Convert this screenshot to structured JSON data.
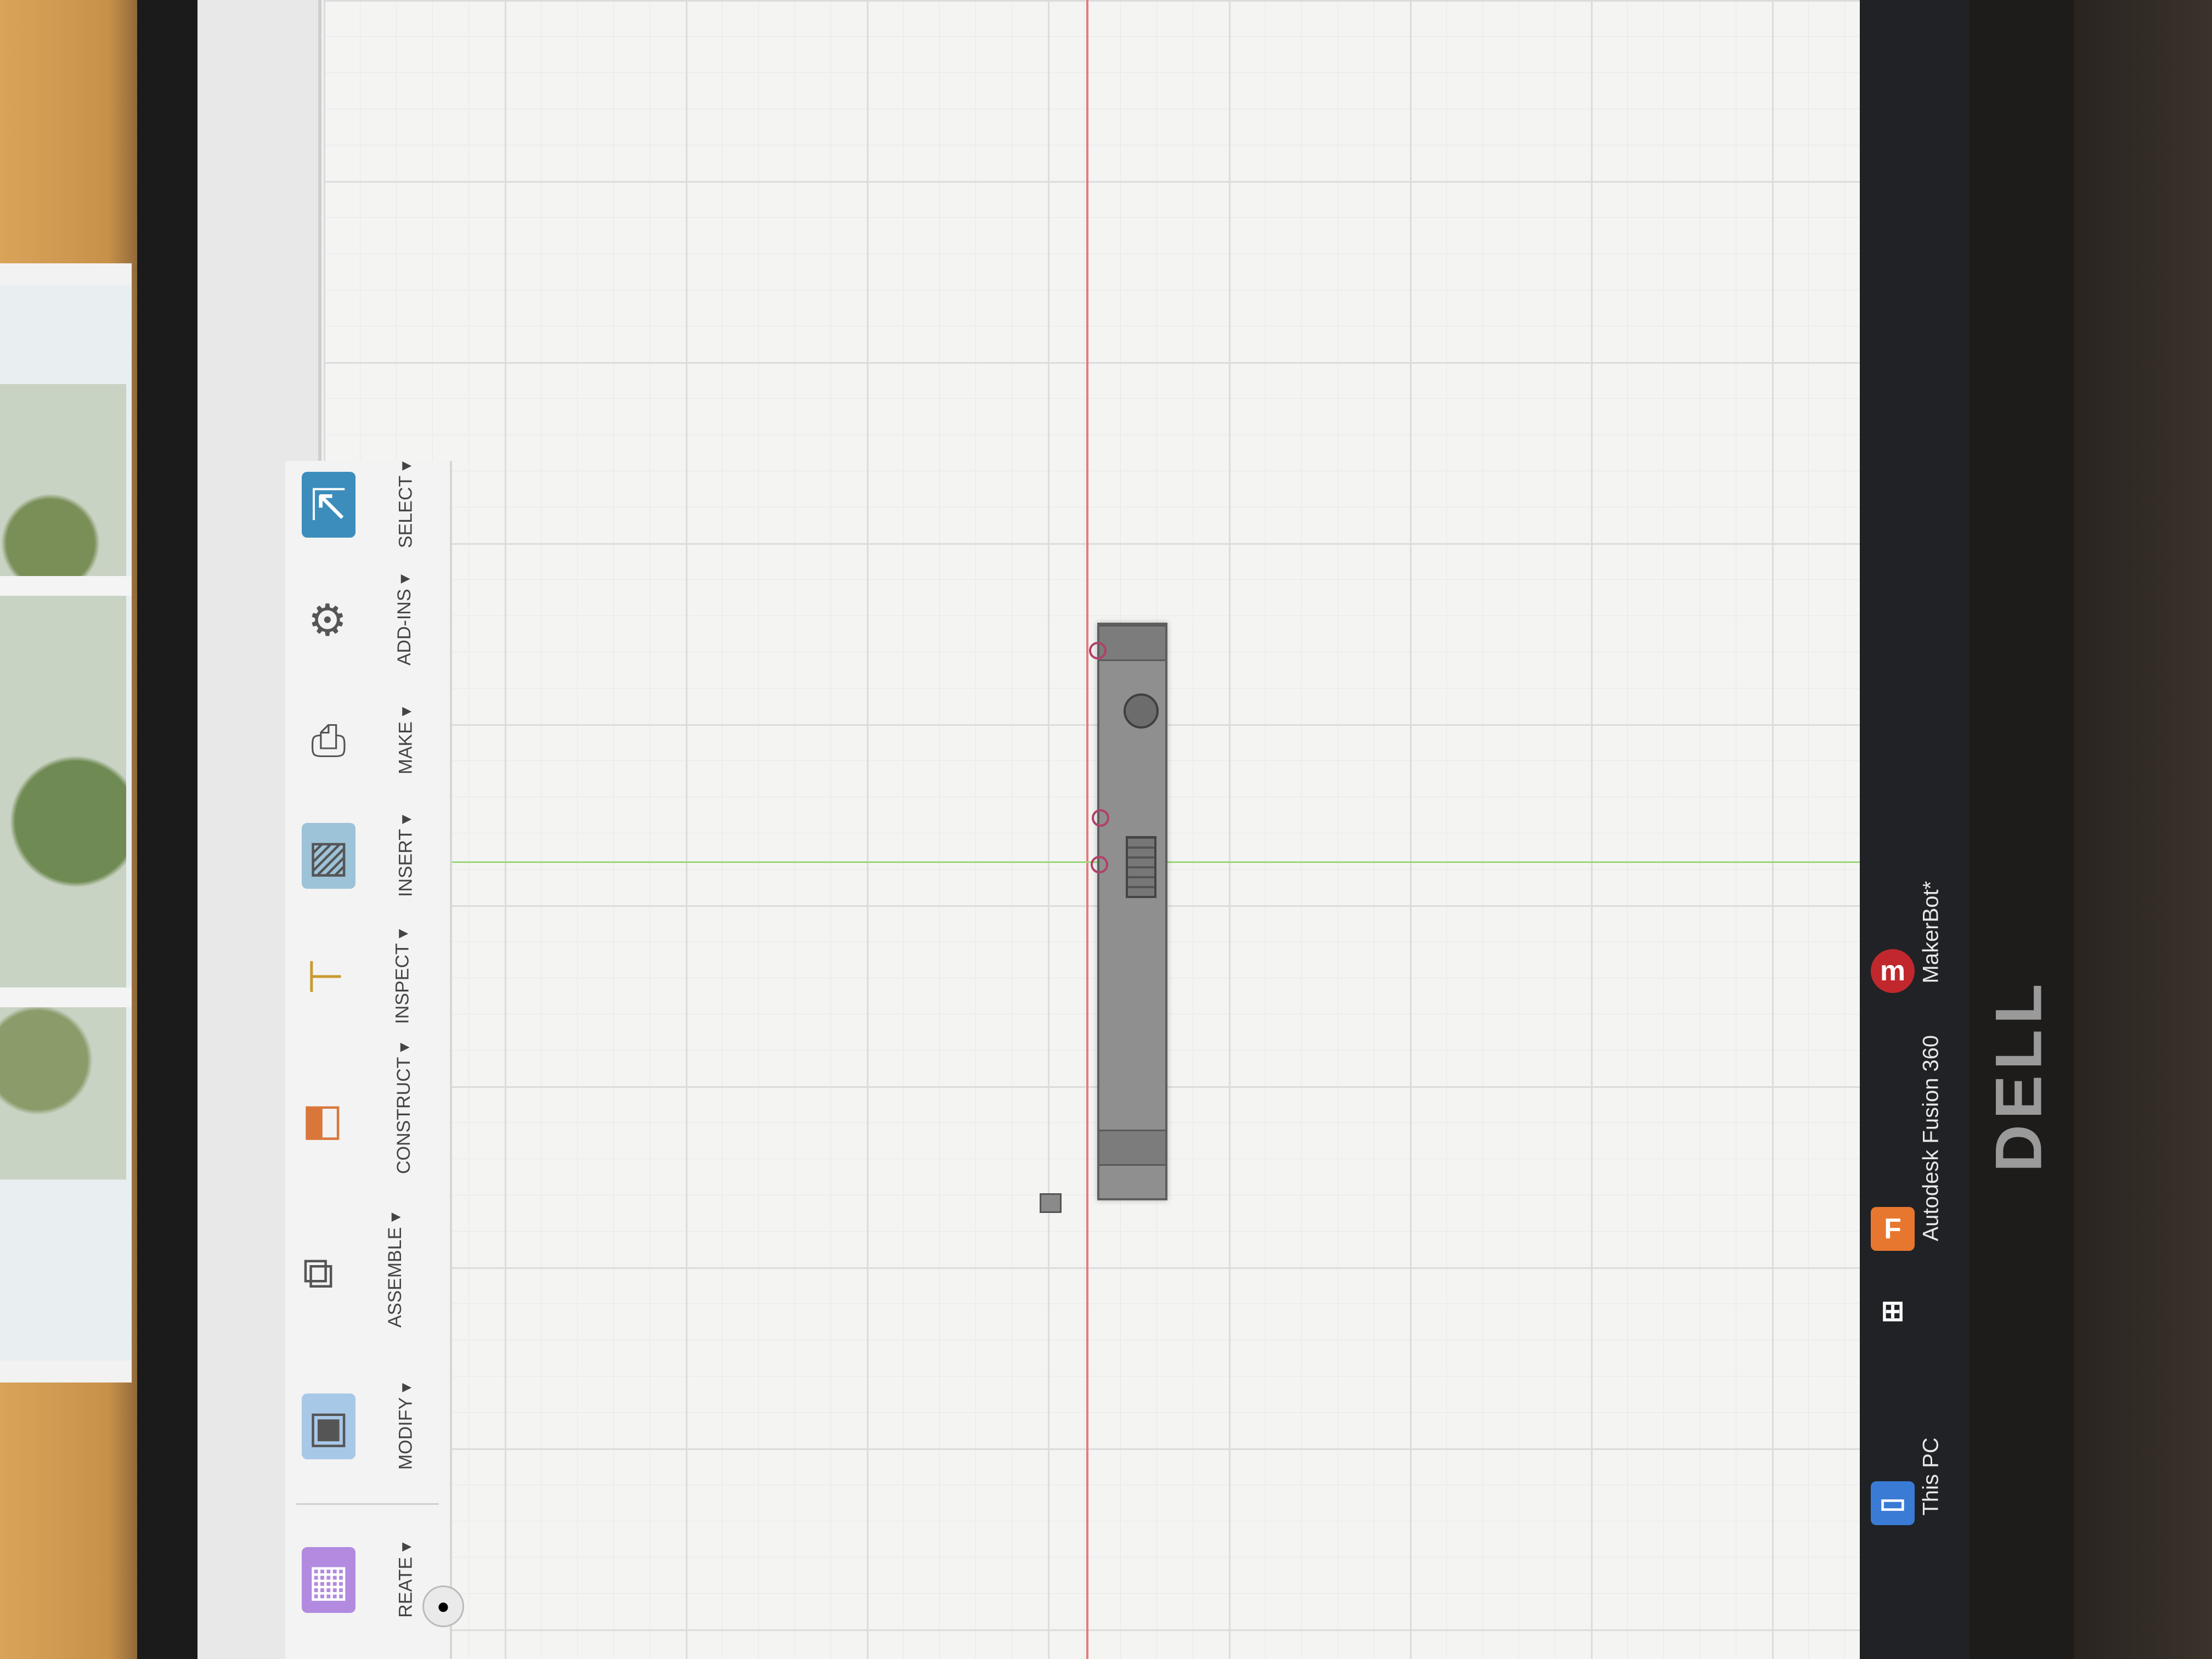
{
  "toolbar": {
    "items": [
      {
        "label": "REATE ▾",
        "icon": "create-icon"
      },
      {
        "label": "MODIFY ▾",
        "icon": "modify-icon"
      },
      {
        "label": "ASSEMBLE ▾",
        "icon": "assemble-icon"
      },
      {
        "label": "CONSTRUCT ▾",
        "icon": "construct-icon"
      },
      {
        "label": "INSPECT ▾",
        "icon": "inspect-icon"
      },
      {
        "label": "INSERT ▾",
        "icon": "insert-icon"
      },
      {
        "label": "MAKE ▾",
        "icon": "make-icon"
      },
      {
        "label": "ADD-INS ▾",
        "icon": "add-ins-icon"
      },
      {
        "label": "SELECT ▾",
        "icon": "select-icon"
      }
    ]
  },
  "taskbar": {
    "items": [
      {
        "label": "This PC",
        "icon": "this-pc-icon"
      },
      {
        "label": "Autodesk Fusion 360",
        "icon": "fusion-icon"
      },
      {
        "label": "MakerBot*",
        "icon": "makerbot-icon"
      }
    ]
  },
  "monitor": {
    "brand": "DELL"
  },
  "colors": {
    "x_axis": "#e57b7b",
    "y_axis": "#9ed67a",
    "taskbar": "#202225",
    "makerbot": "#c0282d",
    "fusion": "#e7772e"
  }
}
